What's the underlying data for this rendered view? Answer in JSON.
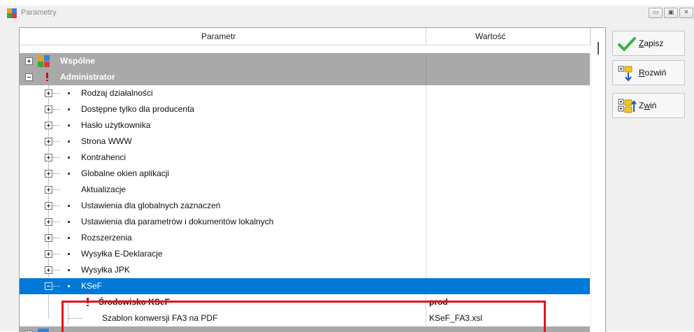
{
  "window": {
    "title": "Parametry"
  },
  "grid": {
    "headers": {
      "param": "Parametr",
      "value": "Wartość"
    },
    "rows": [
      {
        "label": "Wspólne"
      },
      {
        "label": "Administrator"
      },
      {
        "label": "Rodzaj działalności"
      },
      {
        "label": "Dostępne tylko dla producenta"
      },
      {
        "label": "Hasło użytkownika"
      },
      {
        "label": "Strona WWW"
      },
      {
        "label": "Kontrahenci"
      },
      {
        "label": "Globalne okien aplikacji"
      },
      {
        "label": "Aktualizacje"
      },
      {
        "label": "Ustawienia dla globalnych zaznaczeń"
      },
      {
        "label": "Ustawienia dla parametrów i dokumentów lokalnych"
      },
      {
        "label": "Rozszerzenia"
      },
      {
        "label": "Wysyłka E-Deklaracje"
      },
      {
        "label": "Wysyłka JPK"
      },
      {
        "label": "KSeF"
      },
      {
        "label": "Środowisko KSeF",
        "value": "prod"
      },
      {
        "label": "Szablon konwersji FA3 na PDF",
        "value": "KSeF_FA3.xsl"
      }
    ]
  },
  "buttons": {
    "save": {
      "key": "Z",
      "rest": "apisz"
    },
    "expand": {
      "key": "R",
      "rest": "ozwiń"
    },
    "collapse": {
      "pre": "Z",
      "key": "w",
      "rest": "iń"
    }
  },
  "colors": {
    "group_row": "#a9a9a9",
    "selected_row": "#0078d7",
    "required_marker": "#c0141c",
    "highlight_box": "#e0151b"
  },
  "icons": [
    "check-icon",
    "expand-tree-icon",
    "collapse-tree-icon",
    "puzzle-icon",
    "required-marker-icon"
  ]
}
